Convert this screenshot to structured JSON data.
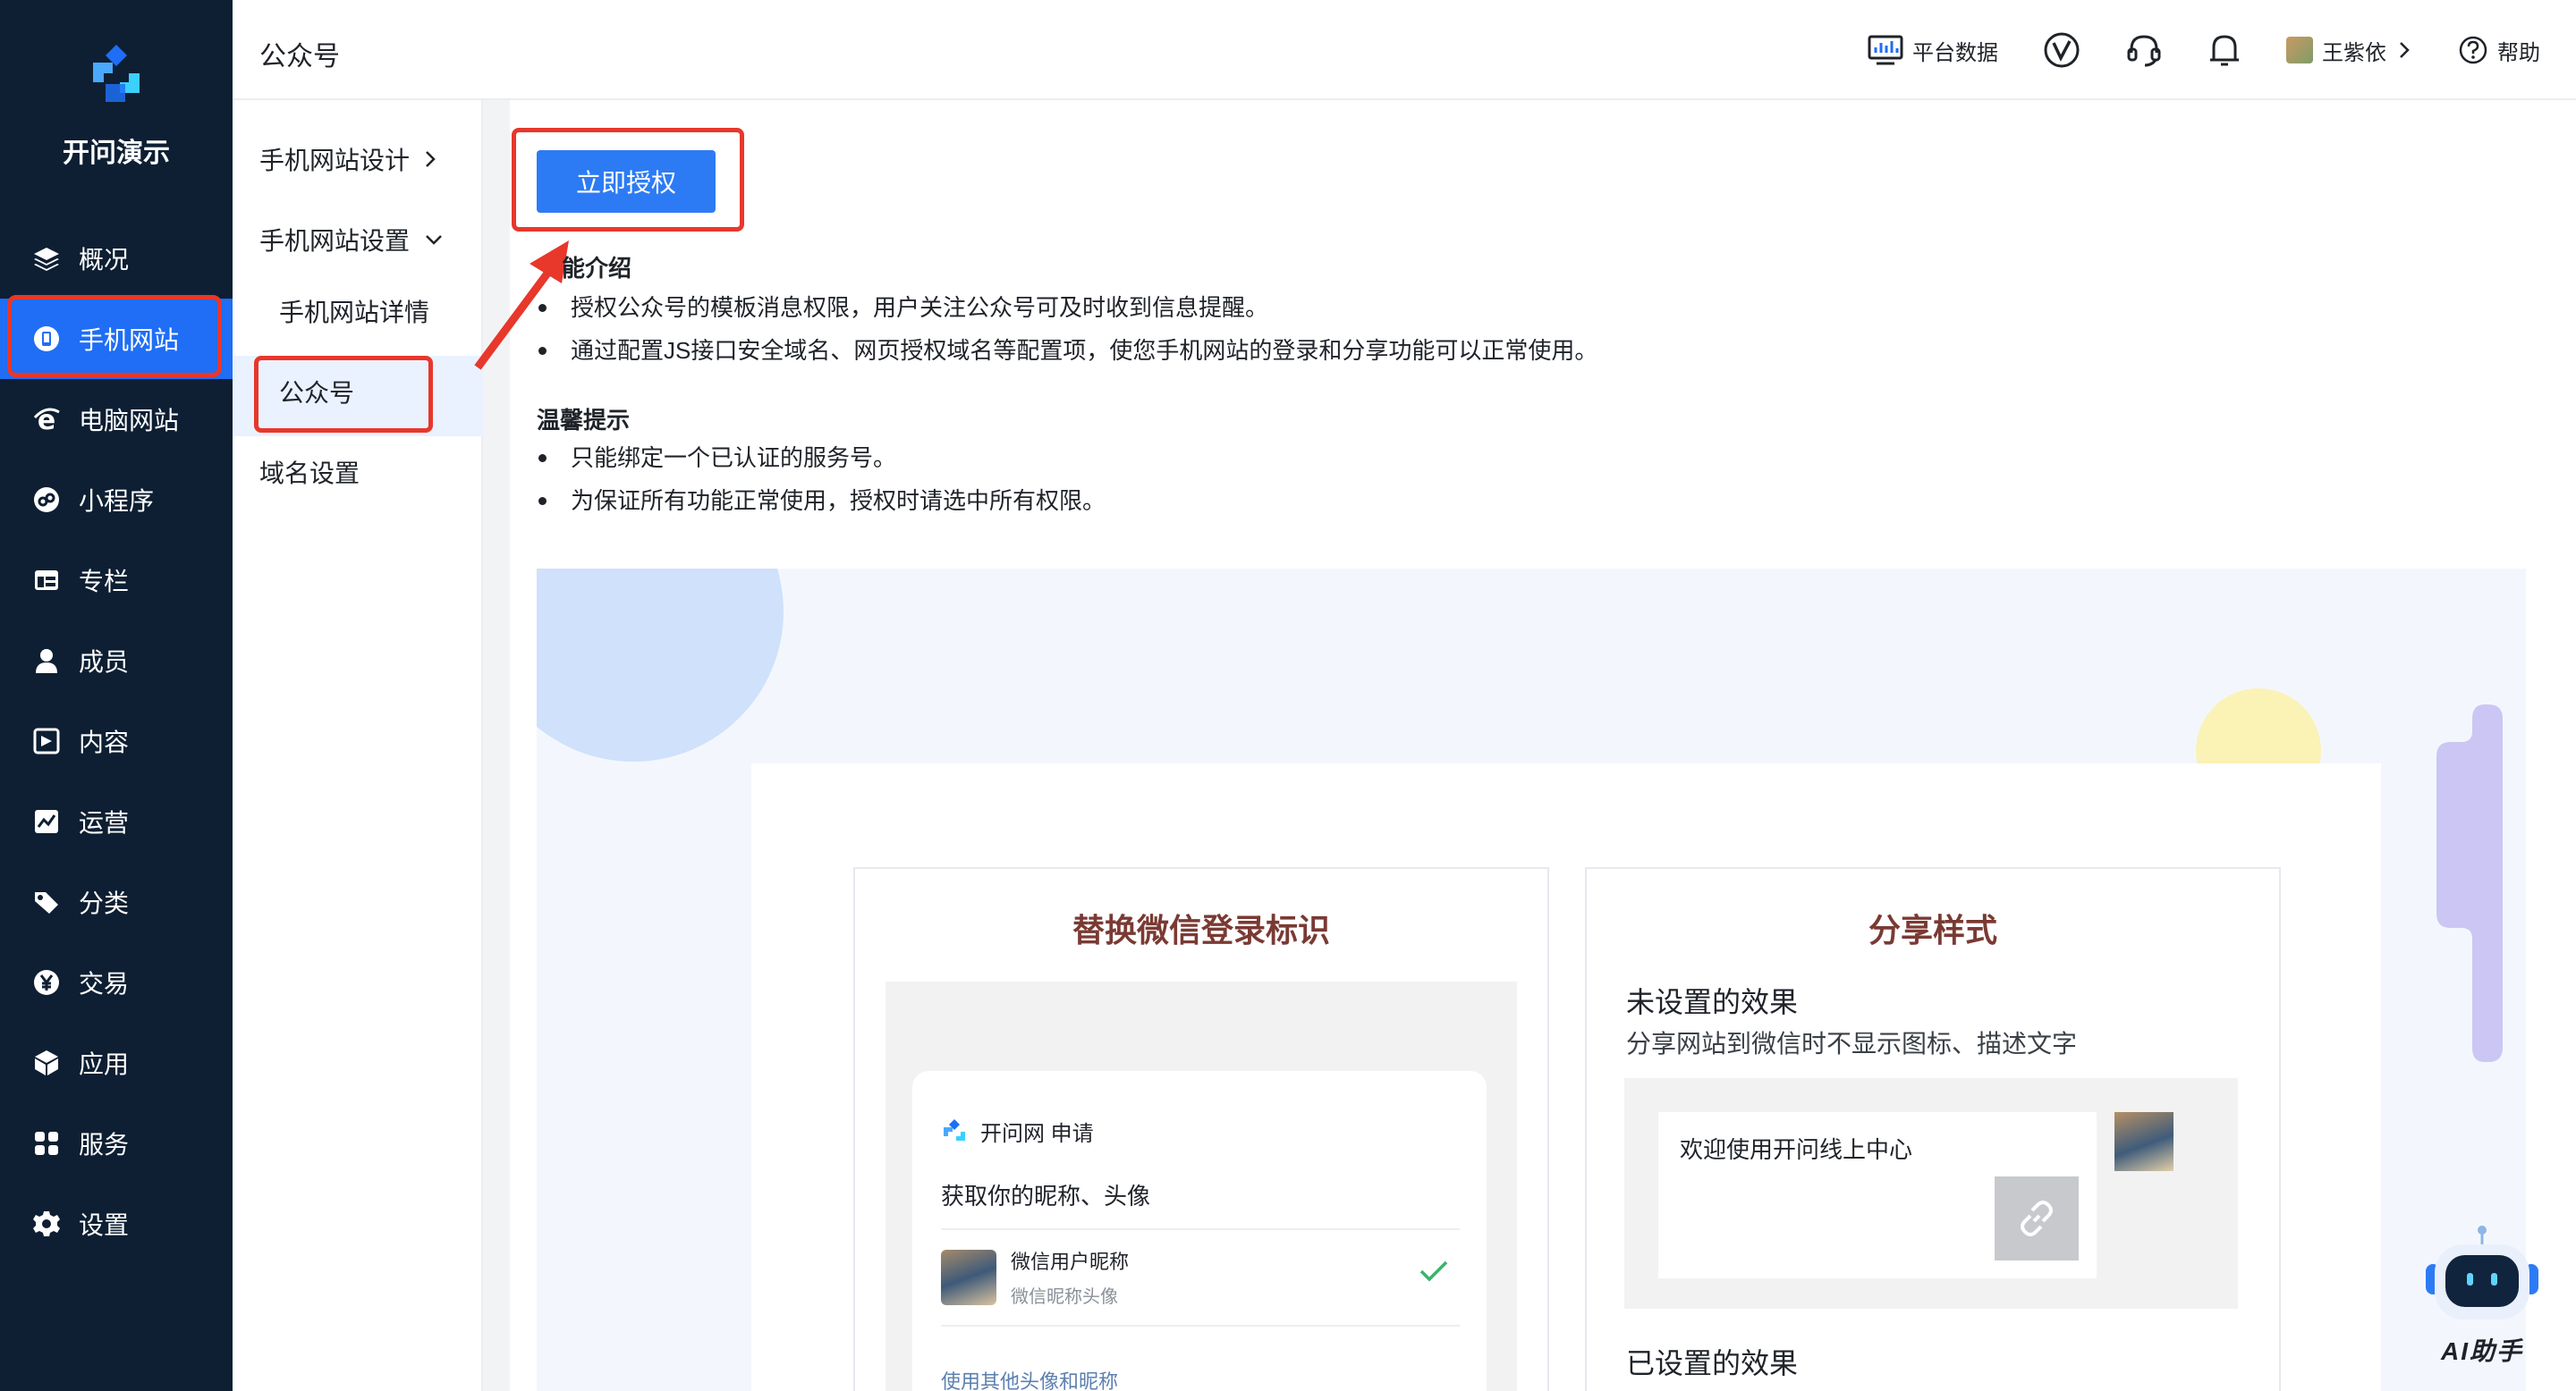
{
  "sidebar": {
    "brand": "开问演示",
    "items": [
      {
        "label": "概况",
        "icon": "layers-icon"
      },
      {
        "label": "手机网站",
        "icon": "mobile-site-icon",
        "active": true
      },
      {
        "label": "电脑网站",
        "icon": "ie-icon"
      },
      {
        "label": "小程序",
        "icon": "mini-program-icon"
      },
      {
        "label": "专栏",
        "icon": "column-icon"
      },
      {
        "label": "成员",
        "icon": "user-icon"
      },
      {
        "label": "内容",
        "icon": "content-icon"
      },
      {
        "label": "运营",
        "icon": "chart-icon"
      },
      {
        "label": "分类",
        "icon": "tag-icon"
      },
      {
        "label": "交易",
        "icon": "yen-icon"
      },
      {
        "label": "应用",
        "icon": "box-icon"
      },
      {
        "label": "服务",
        "icon": "grid-icon"
      },
      {
        "label": "设置",
        "icon": "gear-icon"
      }
    ]
  },
  "header": {
    "title": "公众号",
    "platform_data": "平台数据",
    "user_name": "王紫依",
    "help": "帮助"
  },
  "submenu": {
    "design": "手机网站设计",
    "settings": "手机网站设置",
    "details": "手机网站详情",
    "official": "公众号",
    "domain": "域名设置"
  },
  "main": {
    "authorize_button": "立即授权",
    "intro_title": "能介绍",
    "intro_items": [
      "授权公众号的模板消息权限，用户关注公众号可及时收到信息提醒。",
      "通过配置JS接口安全域名、网页授权域名等配置项，使您手机网站的登录和分享功能可以正常使用。"
    ],
    "tips_title": "温馨提示",
    "tips_items": [
      "只能绑定一个已认证的服务号。",
      "为保证所有功能正常使用，授权时请选中所有权限。"
    ]
  },
  "login_card": {
    "title": "替换微信登录标识",
    "brand_line": "开问网 申请",
    "ask": "获取你的昵称、头像",
    "nickname": "微信用户昵称",
    "avatar_label": "微信昵称头像",
    "other": "使用其他头像和昵称"
  },
  "share_card": {
    "title": "分享样式",
    "unset_title": "未设置的效果",
    "unset_desc": "分享网站到微信时不显示图标、描述文字",
    "preview_text": "欢迎使用开问线上中心",
    "set_title": "已设置的效果"
  },
  "ai_helper": {
    "label": "AI助手"
  },
  "colors": {
    "sidebar_bg": "#0e1f33",
    "accent": "#1f6ef5",
    "button": "#2d7bf4",
    "highlight": "#e8372b",
    "card_title": "#7a3a33"
  }
}
